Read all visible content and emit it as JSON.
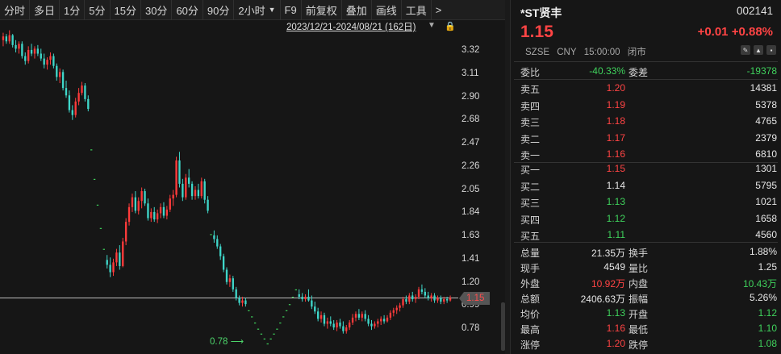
{
  "toolbar": {
    "items": [
      "分时",
      "多日",
      "1分",
      "5分",
      "15分",
      "30分",
      "60分",
      "90分",
      "2小时",
      "F9",
      "前复权",
      "叠加",
      "画线",
      "工具",
      ">"
    ]
  },
  "chart": {
    "range_label": "2023/12/21-2024/08/21 (162日)",
    "price_axis": [
      "3.32",
      "3.11",
      "2.90",
      "2.68",
      "2.47",
      "2.26",
      "2.05",
      "1.84",
      "1.63",
      "1.41",
      "1.20",
      "0.99",
      "0.78"
    ],
    "current_price_tag": "1.15",
    "low_marker": "0.78",
    "colors": {
      "up": "#ff3b3b",
      "down": "#3fd6c9",
      "limit": "#3fd25c"
    }
  },
  "chart_data": {
    "type": "candlestick",
    "title": "",
    "ylim": [
      0.72,
      3.36
    ],
    "candles": [
      [
        3.25,
        3.31,
        3.2,
        3.28
      ],
      [
        3.28,
        3.3,
        3.22,
        3.24
      ],
      [
        3.24,
        3.33,
        3.22,
        3.29
      ],
      [
        3.29,
        3.3,
        3.19,
        3.21
      ],
      [
        3.21,
        3.25,
        3.15,
        3.18
      ],
      [
        3.18,
        3.24,
        3.14,
        3.22
      ],
      [
        3.22,
        3.24,
        3.1,
        3.12
      ],
      [
        3.12,
        3.15,
        3.05,
        3.08
      ],
      [
        3.08,
        3.2,
        3.06,
        3.17
      ],
      [
        3.17,
        3.22,
        3.12,
        3.14
      ],
      [
        3.14,
        3.2,
        3.1,
        3.18
      ],
      [
        3.18,
        3.21,
        3.12,
        3.14
      ],
      [
        3.14,
        3.18,
        3.08,
        3.1
      ],
      [
        3.1,
        3.14,
        3.02,
        3.05
      ],
      [
        3.05,
        3.11,
        3.01,
        3.09
      ],
      [
        3.09,
        3.15,
        3.05,
        3.12
      ],
      [
        3.12,
        3.14,
        3.02,
        3.04
      ],
      [
        3.04,
        3.06,
        2.92,
        2.95
      ],
      [
        2.95,
        3.02,
        2.9,
        2.99
      ],
      [
        2.99,
        3.01,
        2.84,
        2.86
      ],
      [
        2.86,
        2.92,
        2.78,
        2.8
      ],
      [
        2.8,
        2.84,
        2.66,
        2.68
      ],
      [
        2.68,
        2.72,
        2.6,
        2.64
      ],
      [
        2.64,
        2.78,
        2.62,
        2.75
      ],
      [
        2.75,
        2.86,
        2.72,
        2.82
      ],
      [
        2.82,
        2.91,
        2.8,
        2.88
      ],
      [
        2.88,
        2.9,
        2.75,
        2.77
      ],
      [
        2.77,
        2.8,
        2.67,
        2.69
      ],
      [
        2.36,
        2.36,
        2.36,
        2.36
      ],
      [
        2.12,
        2.12,
        2.12,
        2.12
      ],
      [
        1.91,
        1.91,
        1.91,
        1.91
      ],
      [
        1.72,
        1.72,
        1.72,
        1.72
      ],
      [
        1.55,
        1.55,
        1.55,
        1.55
      ],
      [
        1.46,
        1.5,
        1.39,
        1.42
      ],
      [
        1.42,
        1.48,
        1.32,
        1.36
      ],
      [
        1.36,
        1.47,
        1.33,
        1.44
      ],
      [
        1.44,
        1.55,
        1.41,
        1.52
      ],
      [
        1.52,
        1.58,
        1.38,
        1.41
      ],
      [
        1.41,
        1.64,
        1.4,
        1.61
      ],
      [
        1.61,
        1.8,
        1.58,
        1.77
      ],
      [
        1.77,
        1.92,
        1.74,
        1.89
      ],
      [
        1.89,
        2.0,
        1.85,
        1.97
      ],
      [
        1.97,
        2.02,
        1.84,
        1.86
      ],
      [
        1.86,
        1.97,
        1.83,
        1.94
      ],
      [
        1.94,
        2.05,
        1.88,
        2.02
      ],
      [
        2.02,
        2.04,
        1.9,
        1.92
      ],
      [
        1.92,
        1.96,
        1.78,
        1.8
      ],
      [
        1.8,
        1.88,
        1.77,
        1.85
      ],
      [
        1.85,
        1.89,
        1.77,
        1.79
      ],
      [
        1.79,
        1.87,
        1.76,
        1.84
      ],
      [
        1.84,
        1.92,
        1.8,
        1.89
      ],
      [
        1.89,
        1.93,
        1.8,
        1.82
      ],
      [
        1.82,
        1.9,
        1.79,
        1.87
      ],
      [
        1.87,
        1.99,
        1.85,
        1.96
      ],
      [
        1.96,
        2.03,
        1.9,
        1.99
      ],
      [
        1.99,
        2.3,
        1.97,
        2.27
      ],
      [
        2.27,
        2.34,
        2.05,
        2.08
      ],
      [
        2.08,
        2.12,
        1.94,
        1.97
      ],
      [
        1.97,
        2.16,
        1.95,
        2.13
      ],
      [
        2.13,
        2.2,
        2.05,
        2.08
      ],
      [
        2.08,
        2.1,
        1.95,
        1.98
      ],
      [
        1.98,
        2.06,
        1.95,
        2.03
      ],
      [
        2.03,
        2.08,
        1.96,
        1.98
      ],
      [
        1.98,
        2.13,
        1.96,
        2.1
      ],
      [
        2.1,
        2.12,
        1.92,
        1.95
      ],
      [
        1.95,
        1.98,
        1.84,
        1.86
      ],
      [
        1.67,
        1.67,
        1.67,
        1.67
      ],
      [
        1.66,
        1.7,
        1.6,
        1.63
      ],
      [
        1.63,
        1.66,
        1.55,
        1.57
      ],
      [
        1.57,
        1.59,
        1.46,
        1.49
      ],
      [
        1.49,
        1.51,
        1.36,
        1.38
      ],
      [
        1.38,
        1.4,
        1.26,
        1.28
      ],
      [
        1.28,
        1.34,
        1.24,
        1.31
      ],
      [
        1.31,
        1.33,
        1.2,
        1.22
      ],
      [
        1.22,
        1.24,
        1.13,
        1.15
      ],
      [
        1.15,
        1.17,
        1.09,
        1.11
      ],
      [
        1.11,
        1.16,
        1.08,
        1.13
      ],
      [
        1.13,
        1.15,
        1.08,
        1.1
      ],
      [
        1.05,
        1.05,
        1.05,
        1.05
      ],
      [
        1.0,
        1.0,
        1.0,
        1.0
      ],
      [
        0.95,
        0.95,
        0.95,
        0.95
      ],
      [
        0.9,
        0.9,
        0.9,
        0.9
      ],
      [
        0.86,
        0.86,
        0.86,
        0.86
      ],
      [
        0.82,
        0.82,
        0.82,
        0.82
      ],
      [
        0.78,
        0.78,
        0.78,
        0.78
      ],
      [
        0.82,
        0.82,
        0.82,
        0.82
      ],
      [
        0.86,
        0.86,
        0.86,
        0.86
      ],
      [
        0.9,
        0.9,
        0.9,
        0.9
      ],
      [
        0.95,
        0.95,
        0.95,
        0.95
      ],
      [
        1.0,
        1.0,
        1.0,
        1.0
      ],
      [
        1.05,
        1.05,
        1.05,
        1.05
      ],
      [
        1.1,
        1.1,
        1.1,
        1.1
      ],
      [
        1.16,
        1.16,
        1.16,
        1.16
      ],
      [
        1.22,
        1.22,
        1.22,
        1.22
      ],
      [
        1.18,
        1.22,
        1.14,
        1.16
      ],
      [
        1.16,
        1.19,
        1.12,
        1.14
      ],
      [
        1.14,
        1.18,
        1.12,
        1.16
      ],
      [
        1.16,
        1.22,
        1.12,
        1.13
      ],
      [
        1.13,
        1.17,
        1.06,
        1.08
      ],
      [
        1.08,
        1.12,
        1.02,
        1.04
      ],
      [
        1.04,
        1.07,
        0.96,
        0.98
      ],
      [
        0.98,
        1.04,
        0.95,
        1.01
      ],
      [
        1.01,
        1.03,
        0.92,
        0.94
      ],
      [
        0.94,
        0.99,
        0.9,
        0.96
      ],
      [
        0.96,
        1.0,
        0.92,
        0.94
      ],
      [
        0.94,
        0.97,
        0.89,
        0.91
      ],
      [
        0.91,
        0.97,
        0.88,
        0.95
      ],
      [
        0.95,
        0.98,
        0.9,
        0.92
      ],
      [
        0.92,
        0.96,
        0.86,
        0.88
      ],
      [
        0.88,
        0.93,
        0.86,
        0.91
      ],
      [
        0.91,
        0.97,
        0.89,
        0.95
      ],
      [
        0.95,
        1.02,
        0.93,
        0.99
      ],
      [
        0.99,
        1.04,
        0.96,
        1.02
      ],
      [
        1.02,
        1.06,
        0.97,
        0.99
      ],
      [
        0.99,
        1.04,
        0.96,
        1.02
      ],
      [
        1.02,
        1.05,
        0.96,
        0.98
      ],
      [
        0.98,
        1.01,
        0.92,
        0.94
      ],
      [
        0.94,
        0.97,
        0.89,
        0.92
      ],
      [
        0.92,
        0.96,
        0.9,
        0.94
      ],
      [
        0.94,
        0.98,
        0.91,
        0.96
      ],
      [
        0.96,
        1.0,
        0.93,
        0.98
      ],
      [
        0.98,
        1.01,
        0.94,
        0.96
      ],
      [
        0.96,
        1.01,
        0.95,
        0.99
      ],
      [
        0.99,
        1.05,
        0.97,
        1.03
      ],
      [
        1.03,
        1.07,
        1.0,
        1.05
      ],
      [
        1.05,
        1.09,
        1.02,
        1.07
      ],
      [
        1.07,
        1.11,
        1.04,
        1.09
      ],
      [
        1.09,
        1.16,
        1.07,
        1.14
      ],
      [
        1.14,
        1.17,
        1.1,
        1.12
      ],
      [
        1.12,
        1.19,
        1.1,
        1.17
      ],
      [
        1.17,
        1.2,
        1.12,
        1.14
      ],
      [
        1.14,
        1.18,
        1.11,
        1.16
      ],
      [
        1.16,
        1.24,
        1.14,
        1.22
      ],
      [
        1.22,
        1.26,
        1.18,
        1.2
      ],
      [
        1.2,
        1.23,
        1.15,
        1.17
      ],
      [
        1.17,
        1.2,
        1.13,
        1.15
      ],
      [
        1.15,
        1.19,
        1.12,
        1.17
      ],
      [
        1.17,
        1.19,
        1.11,
        1.13
      ],
      [
        1.13,
        1.17,
        1.11,
        1.15
      ],
      [
        1.15,
        1.17,
        1.1,
        1.12
      ],
      [
        1.12,
        1.16,
        1.1,
        1.14
      ],
      [
        1.14,
        1.16,
        1.11,
        1.13
      ],
      [
        1.13,
        1.17,
        1.12,
        1.15
      ]
    ]
  },
  "quote": {
    "name": "*ST贤丰",
    "code": "002141",
    "price": "1.15",
    "change": "+0.01",
    "change_pct": "+0.88%",
    "exchange": "SZSE",
    "currency": "CNY",
    "time": "15:00:00",
    "status": "闭市",
    "weibi_label": "委比",
    "weibi_value": "-40.33%",
    "weicha_label": "委差",
    "weicha_value": "-19378",
    "asks": [
      {
        "label": "卖五",
        "price": "1.20",
        "vol": "14381"
      },
      {
        "label": "卖四",
        "price": "1.19",
        "vol": "5378"
      },
      {
        "label": "卖三",
        "price": "1.18",
        "vol": "4765"
      },
      {
        "label": "卖二",
        "price": "1.17",
        "vol": "2379"
      },
      {
        "label": "卖一",
        "price": "1.16",
        "vol": "6810"
      }
    ],
    "bids": [
      {
        "label": "买一",
        "price": "1.15",
        "vol": "1301"
      },
      {
        "label": "买二",
        "price": "1.14",
        "vol": "5795"
      },
      {
        "label": "买三",
        "price": "1.13",
        "vol": "1021"
      },
      {
        "label": "买四",
        "price": "1.12",
        "vol": "1658"
      },
      {
        "label": "买五",
        "price": "1.11",
        "vol": "4560"
      }
    ],
    "stats": [
      {
        "l1": "总量",
        "v1": "21.35万",
        "l2": "换手",
        "v2": "1.88%"
      },
      {
        "l1": "现手",
        "v1": "4549",
        "l2": "量比",
        "v2": "1.25"
      },
      {
        "l1": "外盘",
        "v1": "10.92万",
        "l2": "内盘",
        "v2": "10.43万"
      },
      {
        "l1": "总额",
        "v1": "2406.63万",
        "l2": "振幅",
        "v2": "5.26%"
      },
      {
        "l1": "均价",
        "v1": "1.13",
        "l2": "开盘",
        "v2": "1.12"
      },
      {
        "l1": "最高",
        "v1": "1.16",
        "l2": "最低",
        "v2": "1.10"
      },
      {
        "l1": "涨停",
        "v1": "1.20",
        "l2": "跌停",
        "v2": "1.08"
      }
    ]
  }
}
